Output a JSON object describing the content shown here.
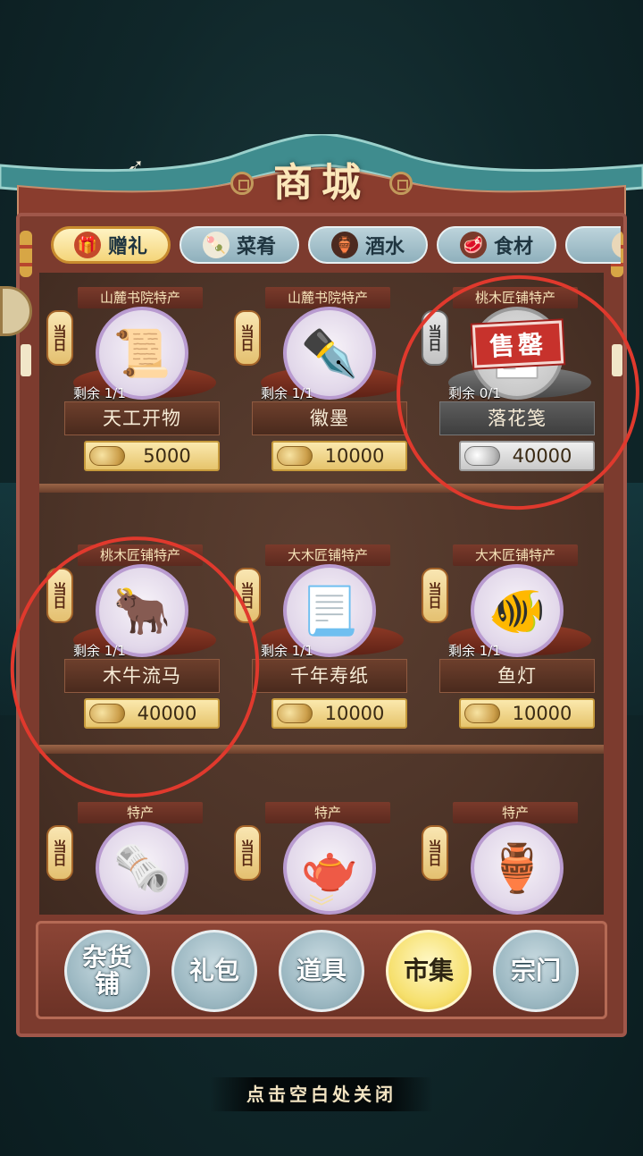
{
  "title": "商城",
  "tabs": [
    {
      "label": "赠礼",
      "icon": "gift-box-icon",
      "active": true
    },
    {
      "label": "菜肴",
      "icon": "dish-icon",
      "active": false
    },
    {
      "label": "酒水",
      "icon": "wine-jar-icon",
      "active": false
    },
    {
      "label": "食材",
      "icon": "ingredient-icon",
      "active": false
    }
  ],
  "lantern_text": "当日",
  "items": [
    {
      "origin": "山麓书院特产",
      "name": "天工开物",
      "stock": "剩余 1/1",
      "price": "5000",
      "icon": "book-icon",
      "sold": false
    },
    {
      "origin": "山麓书院特产",
      "name": "徽墨",
      "stock": "剩余 1/1",
      "price": "10000",
      "icon": "ink-stick-icon",
      "sold": false
    },
    {
      "origin": "桃木匠铺特产",
      "name": "落花笺",
      "stock": "剩余 0/1",
      "price": "40000",
      "icon": "letter-paper-icon",
      "sold": true,
      "sold_label": "售罄"
    },
    {
      "origin": "桃木匠铺特产",
      "name": "木牛流马",
      "stock": "剩余 1/1",
      "price": "40000",
      "icon": "wooden-ox-cart-icon",
      "sold": false
    },
    {
      "origin": "大木匠铺特产",
      "name": "千年寿纸",
      "stock": "剩余 1/1",
      "price": "10000",
      "icon": "paper-scroll-icon",
      "sold": false
    },
    {
      "origin": "大木匠铺特产",
      "name": "鱼灯",
      "stock": "剩余 1/1",
      "price": "10000",
      "icon": "fish-lantern-icon",
      "sold": false
    },
    {
      "origin": "特产",
      "icon": "paintings-icon"
    },
    {
      "origin": "特产",
      "icon": "teapot-icon"
    },
    {
      "origin": "特产",
      "icon": "porcelain-jar-icon"
    }
  ],
  "nav": [
    {
      "label": "杂货铺",
      "active": false
    },
    {
      "label": "礼包",
      "active": false
    },
    {
      "label": "道具",
      "active": false
    },
    {
      "label": "市集",
      "active": true
    },
    {
      "label": "宗门",
      "active": false
    }
  ],
  "close_hint": "点击空白处关闭",
  "colors": {
    "annotation": "#e0392d",
    "accent_gold": "#f4d57a",
    "cabinet": "#7c3b2e"
  }
}
